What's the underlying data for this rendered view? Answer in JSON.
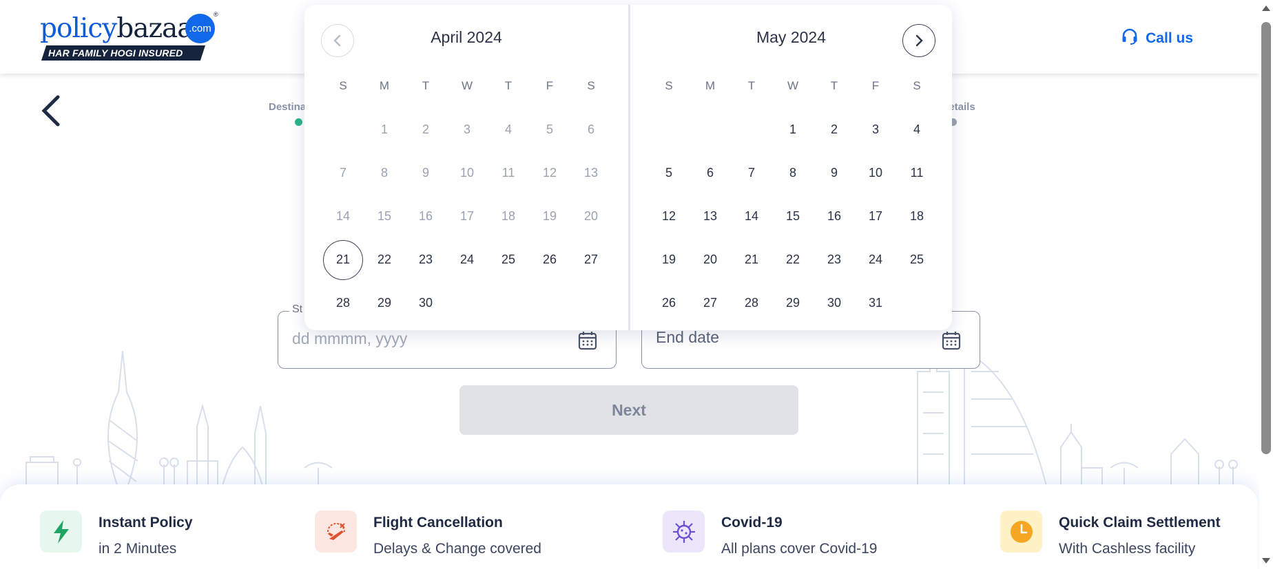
{
  "header": {
    "logo": {
      "word_policy": "policy",
      "word_bazaar": "bazaar",
      "com": ".com",
      "registered": "®",
      "tagline": "HAR FAMILY HOGI INSURED"
    },
    "call_us_label": "Call us",
    "call_icon": "headset-icon"
  },
  "stepper": {
    "first_label_visible": "Destina",
    "last_label_visible": "t details"
  },
  "form": {
    "start_field": {
      "label_visible": "St",
      "placeholder": "dd mmmm, yyyy"
    },
    "end_field": {
      "placeholder": "End date"
    },
    "next_label": "Next"
  },
  "calendar": {
    "weekdays": [
      "S",
      "M",
      "T",
      "W",
      "T",
      "F",
      "S"
    ],
    "left": {
      "title": "April 2024",
      "leading_blanks": 1,
      "days": 30,
      "disabled_through": 20,
      "highlighted": 21
    },
    "right": {
      "title": "May 2024",
      "leading_blanks": 3,
      "days": 31,
      "disabled_through": 0,
      "highlighted": null
    },
    "prev_icon": "chevron-left-icon",
    "next_icon": "chevron-right-icon"
  },
  "features": [
    {
      "title": "Instant Policy",
      "subtitle": "in 2 Minutes",
      "icon": "lightning-icon",
      "bg": "#e6f7ee",
      "fg": "#1fa463"
    },
    {
      "title": "Flight Cancellation",
      "subtitle": "Delays & Change covered",
      "icon": "flight-cancel-icon",
      "bg": "#fde7e2",
      "fg": "#e3522f"
    },
    {
      "title": "Covid-19",
      "subtitle": "All plans cover Covid-19",
      "icon": "virus-icon",
      "bg": "#ece6fb",
      "fg": "#6f4fd0"
    },
    {
      "title": "Quick Claim Settlement",
      "subtitle": "With Cashless facility",
      "icon": "clock-icon",
      "bg": "#fff2c6",
      "fg": "#f5a623"
    }
  ],
  "colors": {
    "brand_blue": "#1168e9",
    "navy": "#16233d",
    "stepper_done": "#2bb58a",
    "stepper_pending": "#9aa1b0"
  }
}
